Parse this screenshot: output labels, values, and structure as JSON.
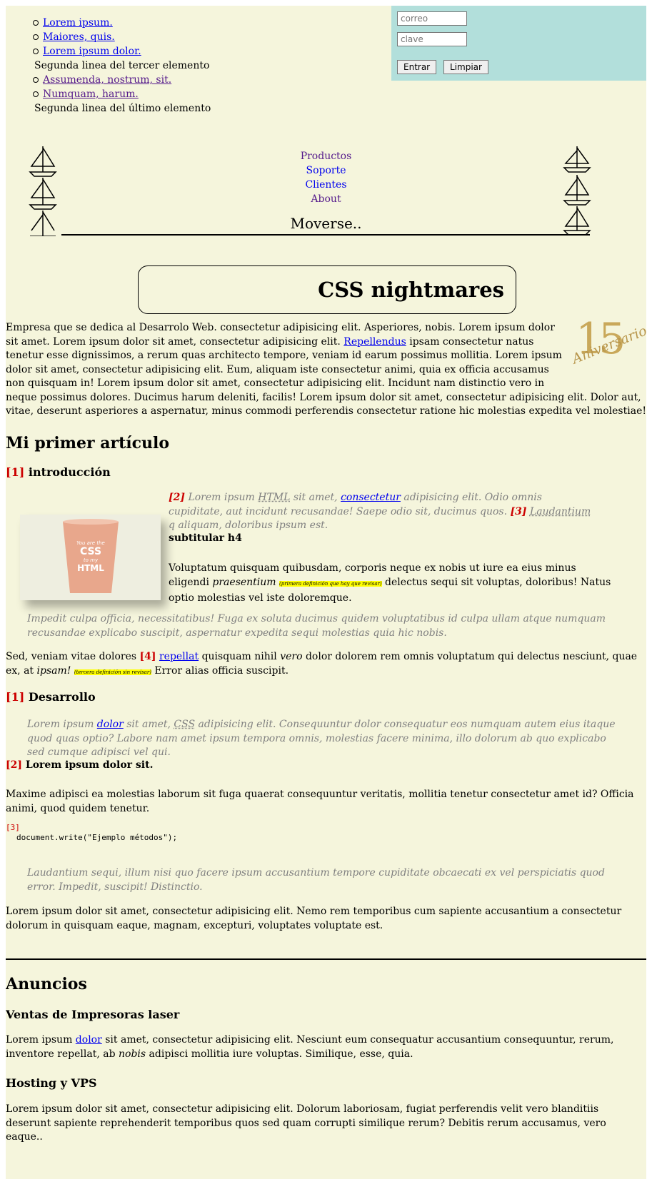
{
  "top_list": {
    "item1": "Lorem ipsum.",
    "item2": "Maiores, quis.",
    "item3": "Lorem ipsum dolor.",
    "item3_line2": "Segunda linea del tercer elemento",
    "item4": "Assumenda, nostrum, sit.",
    "item5": "Numquam, harum.",
    "item5_line2": "Segunda linea del último elemento"
  },
  "login": {
    "email_placeholder": "correo",
    "password_placeholder": "clave",
    "submit_label": "Entrar",
    "reset_label": "Limpiar"
  },
  "nav": {
    "items": [
      "Productos",
      "Soporte",
      "Clientes",
      "About"
    ],
    "caption": "Moverse.."
  },
  "header": {
    "title": "CSS nightmares"
  },
  "badge": {
    "number": "15",
    "text": "Aniversario"
  },
  "intro": {
    "text_a": "Empresa que se dedica al Desarrolo Web. consectetur adipisicing elit. Asperiores, nobis. Lorem ipsum dolor sit amet. Lorem ipsum dolor sit amet, consectetur adipisicing elit. ",
    "link": "Repellendus",
    "text_b": " ipsam consectetur natus tenetur esse dignissimos, a rerum quas architecto tempore, veniam id earum possimus mollitia. Lorem ipsum dolor sit amet, consectetur adipisicing elit. Eum, aliquam iste consectetur animi, quia ex officia accusamus non quisquam in! Lorem ipsum dolor sit amet, consectetur adipisicing elit. Incidunt nam distinctio vero in neque possimus dolores. Ducimus harum deleniti, facilis! Lorem ipsum dolor sit amet, consectetur adipisicing elit. Dolor aut, vitae, deserunt asperiores a aspernatur, minus commodi perferendis consectetur ratione hic molestias expedita vel molestiae!"
  },
  "article": {
    "title": "Mi primer artículo",
    "section1": {
      "num": "[1]",
      "title": "introducción"
    },
    "cup": {
      "line1": "You are the",
      "line2": "CSS",
      "line3": "to my",
      "line4": "HTML"
    },
    "quote1": {
      "ref2": "[2]",
      "t1": " Lorem ipsum ",
      "abbr1": "HTML",
      "t2": " sit amet, ",
      "link1": "consectetur",
      "t3": " adipisicing elit. Odio omnis cupiditate, aut incidunt recusandae! Saepe odio sit, ducimus quos. ",
      "ref3": "[3]",
      "t4": " ",
      "abbr2": "Laudantium",
      "t5": " q aliquam, doloribus ipsum est."
    },
    "subtitle_h4": "subtitular h4",
    "p2": {
      "t1": "Voluptatum quisquam quibusdam, corporis neque ex nobis ut iure ea eius minus eligendi ",
      "em": "praesentium",
      "note": "(primera definición que hay que revisar)",
      "t2": " delectus sequi sit voluptas, doloribus! Natus optio molestias vel iste doloremque."
    },
    "quote2": "Impedit culpa officia, necessitatibus! Fuga ex soluta ducimus quidem voluptatibus id culpa ullam atque numquam recusandae explicabo suscipit, aspernatur expedita sequi molestias quia hic nobis.",
    "p3": {
      "t1": "Sed, veniam vitae dolores ",
      "ref4": "[4]",
      "link": "repellat",
      "t2": " quisquam nihil ",
      "em1": "vero",
      "t3": " dolor dolorem rem omnis voluptatum qui delectus nesciunt, quae ex, at ",
      "em2": "ipsam!",
      "note": "(tercera definición sin revisar)",
      "t4": " Error alias officia suscipit."
    },
    "section2": {
      "num": "[1]",
      "title": "Desarrollo"
    },
    "quote3": {
      "t1": "Lorem ipsum ",
      "link": "dolor",
      "t2": " sit amet, ",
      "abbr": "CSS",
      "t3": " adipisicing elit. Consequuntur dolor consequatur eos numquam autem eius itaque quod quas optio? Labore nam amet ipsum tempora omnis, molestias facere minima, illo dolorum ab quo explicabo sed cumque adipisci vel qui."
    },
    "section3": {
      "num": "[2]",
      "title": "Lorem ipsum dolor sit."
    },
    "p4": "Maxime adipisci ea molestias laborum sit fuga quaerat consequuntur veritatis, mollitia tenetur consectetur amet id? Officia animi, quod quidem tenetur.",
    "code_ref": "[3]",
    "code": "document.write(\"Ejemplo métodos\");",
    "quote4": "Laudantium sequi, illum nisi quo facere ipsum accusantium tempore cupiditate obcaecati ex vel perspiciatis quod error. Impedit, suscipit! Distinctio.",
    "p5": "Lorem ipsum dolor sit amet, consectetur adipisicing elit. Nemo rem temporibus cum sapiente accusantium a consectetur dolorum in quisquam eaque, magnam, excepturi, voluptates voluptate est."
  },
  "ads": {
    "title": "Anuncios",
    "ad1": {
      "title": "Ventas de Impresoras laser",
      "t1": "Lorem ipsum ",
      "link": "dolor",
      "t2": " sit amet, consectetur adipisicing elit. Nesciunt eum consequatur accusantium consequuntur, rerum, inventore repellat, ab ",
      "em": "nobis",
      "t3": " adipisci mollitia iure voluptas. Similique, esse, quia."
    },
    "ad2": {
      "title": "Hosting y VPS",
      "text": "Lorem ipsum dolor sit amet, consectetur adipisicing elit. Dolorum laboriosam, fugiat perferendis velit vero blanditiis deserunt sapiente reprehenderit temporibus quos sed quam corrupti similique rerum? Debitis rerum accusamus, vero eaque.."
    }
  },
  "colors": {
    "page_bg": "#f5f5dc",
    "login_bg": "#b2dfdb",
    "link": "#0000ee",
    "visited": "#551a8b",
    "ref": "#cc0000",
    "highlight": "#ffff00"
  }
}
